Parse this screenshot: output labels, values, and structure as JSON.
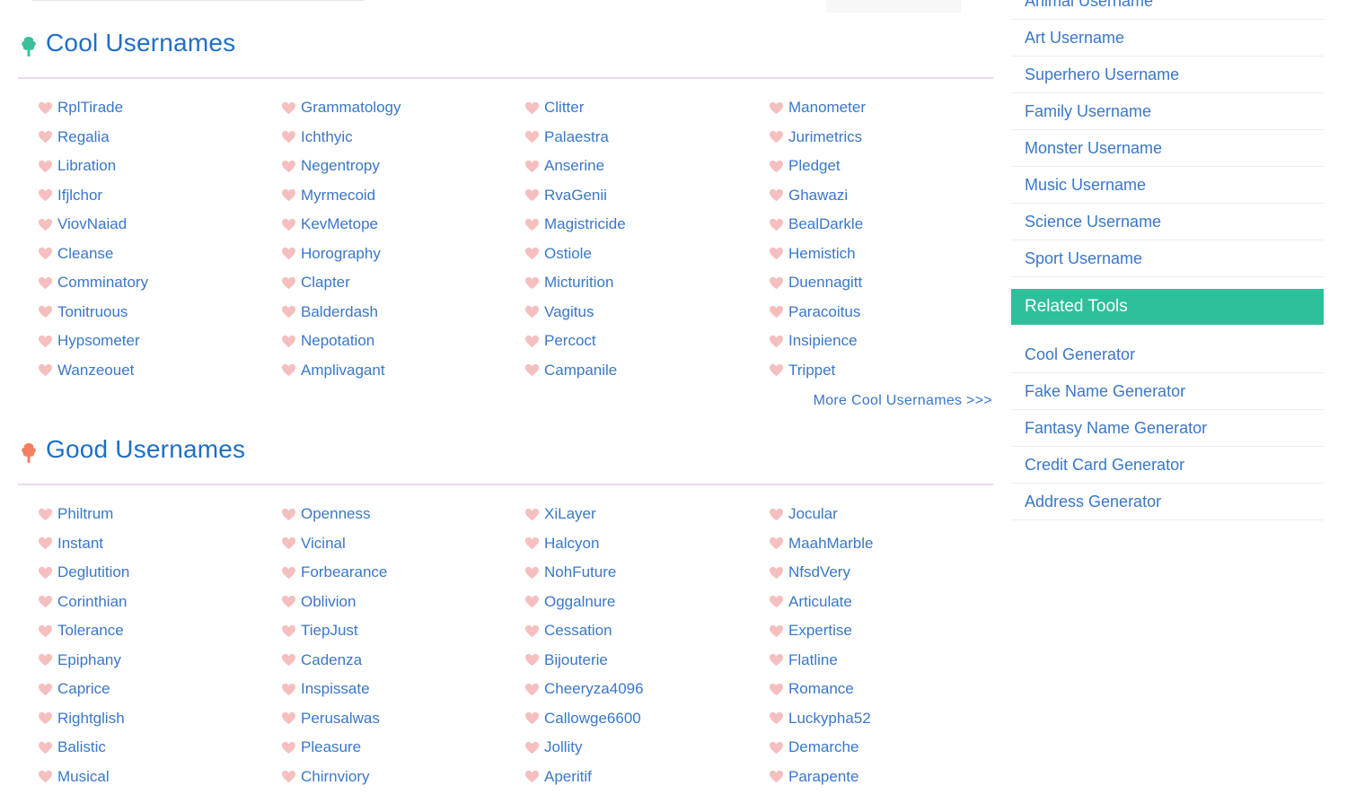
{
  "cool_section": {
    "title": "Cool Usernames",
    "names": [
      [
        "RplTirade",
        "Grammatology",
        "Clitter",
        "Manometer"
      ],
      [
        "Regalia",
        "Ichthyic",
        "Palaestra",
        "Jurimetrics"
      ],
      [
        "Libration",
        "Negentropy",
        "Anserine",
        "Pledget"
      ],
      [
        "Ifjlchor",
        "Myrmecoid",
        "RvaGenii",
        "Ghawazi"
      ],
      [
        "ViovNaiad",
        "KevMetope",
        "Magistricide",
        "BealDarkle"
      ],
      [
        "Cleanse",
        "Horography",
        "Ostiole",
        "Hemistich"
      ],
      [
        "Comminatory",
        "Clapter",
        "Micturition",
        "Duennagitt"
      ],
      [
        "Tonitruous",
        "Balderdash",
        "Vagitus",
        "Paracoitus"
      ],
      [
        "Hypsometer",
        "Nepotation",
        "Percoct",
        "Insipience"
      ],
      [
        "Wanzeouet",
        "Amplivagant",
        "Campanile",
        "Trippet"
      ]
    ],
    "more_link": "More Cool Usernames >>>"
  },
  "good_section": {
    "title": "Good Usernames",
    "names": [
      [
        "Philtrum",
        "Openness",
        "XiLayer",
        "Jocular"
      ],
      [
        "Instant",
        "Vicinal",
        "Halcyon",
        "MaahMarble"
      ],
      [
        "Deglutition",
        "Forbearance",
        "NohFuture",
        "NfsdVery"
      ],
      [
        "Corinthian",
        "Oblivion",
        "Oggalnure",
        "Articulate"
      ],
      [
        "Tolerance",
        "TiepJust",
        "Cessation",
        "Expertise"
      ],
      [
        "Epiphany",
        "Cadenza",
        "Bijouterie",
        "Flatline"
      ],
      [
        "Caprice",
        "Inspissate",
        "Cheeryza4096",
        "Romance"
      ],
      [
        "Rightglish",
        "Perusalwas",
        "Callowge6600",
        "Luckypha52"
      ],
      [
        "Balistic",
        "Pleasure",
        "Jollity",
        "Demarche"
      ],
      [
        "Musical",
        "Chirnviory",
        "Aperitif",
        "Parapente"
      ]
    ]
  },
  "sidebar": {
    "cut_item": "Animal Username",
    "username_links": [
      "Art Username",
      "Superhero Username",
      "Family Username",
      "Monster Username",
      "Music Username",
      "Science Username",
      "Sport Username"
    ],
    "related_header": "Related Tools",
    "tools": [
      "Cool Generator",
      "Fake Name Generator",
      "Fantasy Name Generator",
      "Credit Card Generator",
      "Address Generator"
    ]
  },
  "colors": {
    "heading_blue": "#1f6fc7",
    "link_blue": "#3a77c9",
    "heart_pink": "#f6bfbf",
    "cool_tree_green": "#3dbf9d",
    "good_tree_orange": "#f58061",
    "related_header_bg": "#2ebf9b"
  },
  "icons": {
    "name_bullet": "heart-icon",
    "cool_section_icon": "tree-icon",
    "good_section_icon": "tree-icon"
  }
}
